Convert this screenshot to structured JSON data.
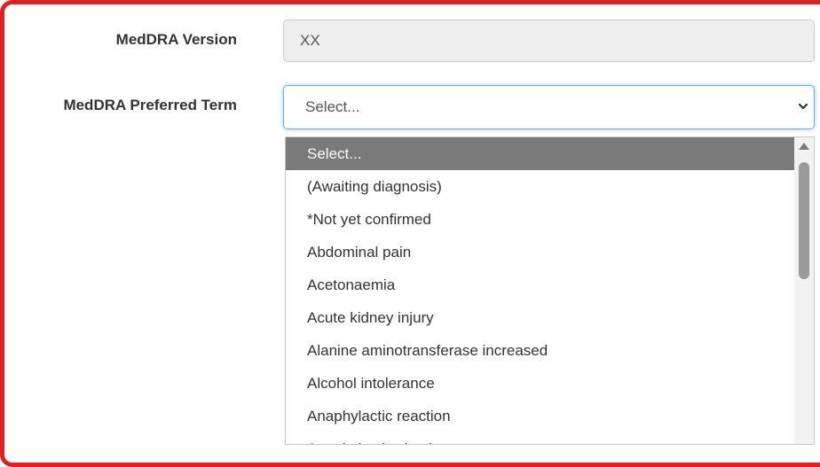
{
  "form": {
    "version_label": "MedDRA Version",
    "version_value": "XX",
    "term_label": "MedDRA Preferred Term",
    "term_selected": "Select..."
  },
  "dropdown": {
    "options": [
      "Select...",
      "(Awaiting diagnosis)",
      "*Not yet confirmed",
      "Abdominal pain",
      "Acetonaemia",
      "Acute kidney injury",
      "Alanine aminotransferase increased",
      "Alcohol intolerance",
      "Anaphylactic reaction",
      "Anaphylactic shock"
    ],
    "highlighted_index": 0
  },
  "colors": {
    "frame_border": "#e02020",
    "focus_border": "#66afe9",
    "highlight_bg": "#7a7a7a"
  },
  "icons": {
    "select_toggle": "chevron-down-icon",
    "scroll_up": "triangle-up-icon"
  }
}
